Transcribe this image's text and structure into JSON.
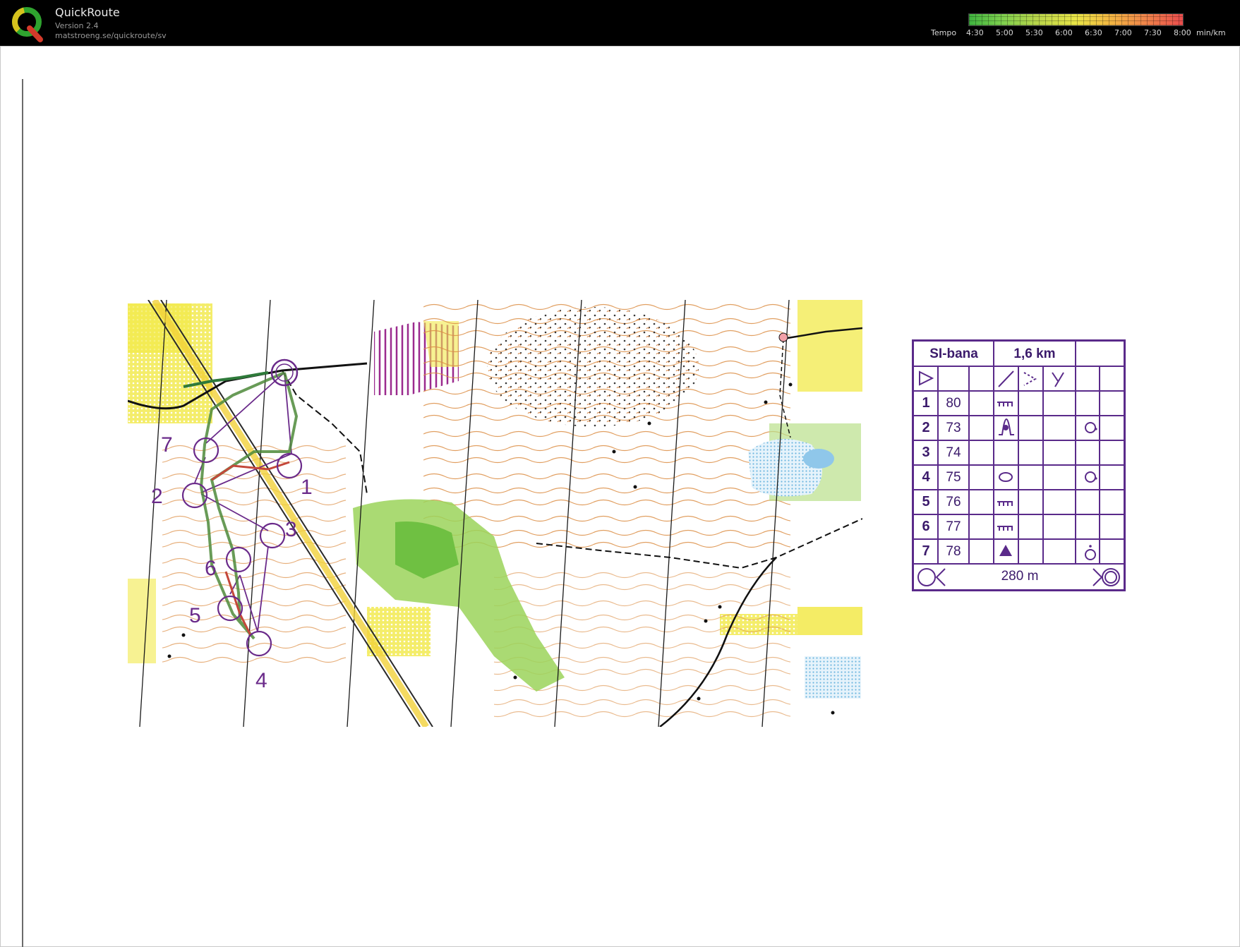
{
  "app": {
    "name": "QuickRoute",
    "version": "Version 2.4",
    "url": "matstroeng.se/quickroute/sv",
    "logo_letter": "Q"
  },
  "tempo": {
    "label": "Tempo",
    "ticks": [
      "4:30",
      "5:00",
      "5:30",
      "6:00",
      "6:30",
      "7:00",
      "7:30",
      "8:00"
    ],
    "unit": "min/km"
  },
  "map": {
    "control_numbers": [
      "1",
      "2",
      "3",
      "4",
      "5",
      "6",
      "7"
    ]
  },
  "description": {
    "course": "SI-bana",
    "length": "1,6 km",
    "controls": [
      {
        "num": "1",
        "code": "80"
      },
      {
        "num": "2",
        "code": "73"
      },
      {
        "num": "3",
        "code": "74"
      },
      {
        "num": "4",
        "code": "75"
      },
      {
        "num": "5",
        "code": "76"
      },
      {
        "num": "6",
        "code": "77"
      },
      {
        "num": "7",
        "code": "78"
      }
    ],
    "finish_distance": "280 m"
  },
  "colors": {
    "course": "#6a2a8a",
    "contour": "#d98a3a",
    "open_land": "#f2e94a",
    "green": "#9bd45a",
    "water": "#8fc7ea"
  }
}
